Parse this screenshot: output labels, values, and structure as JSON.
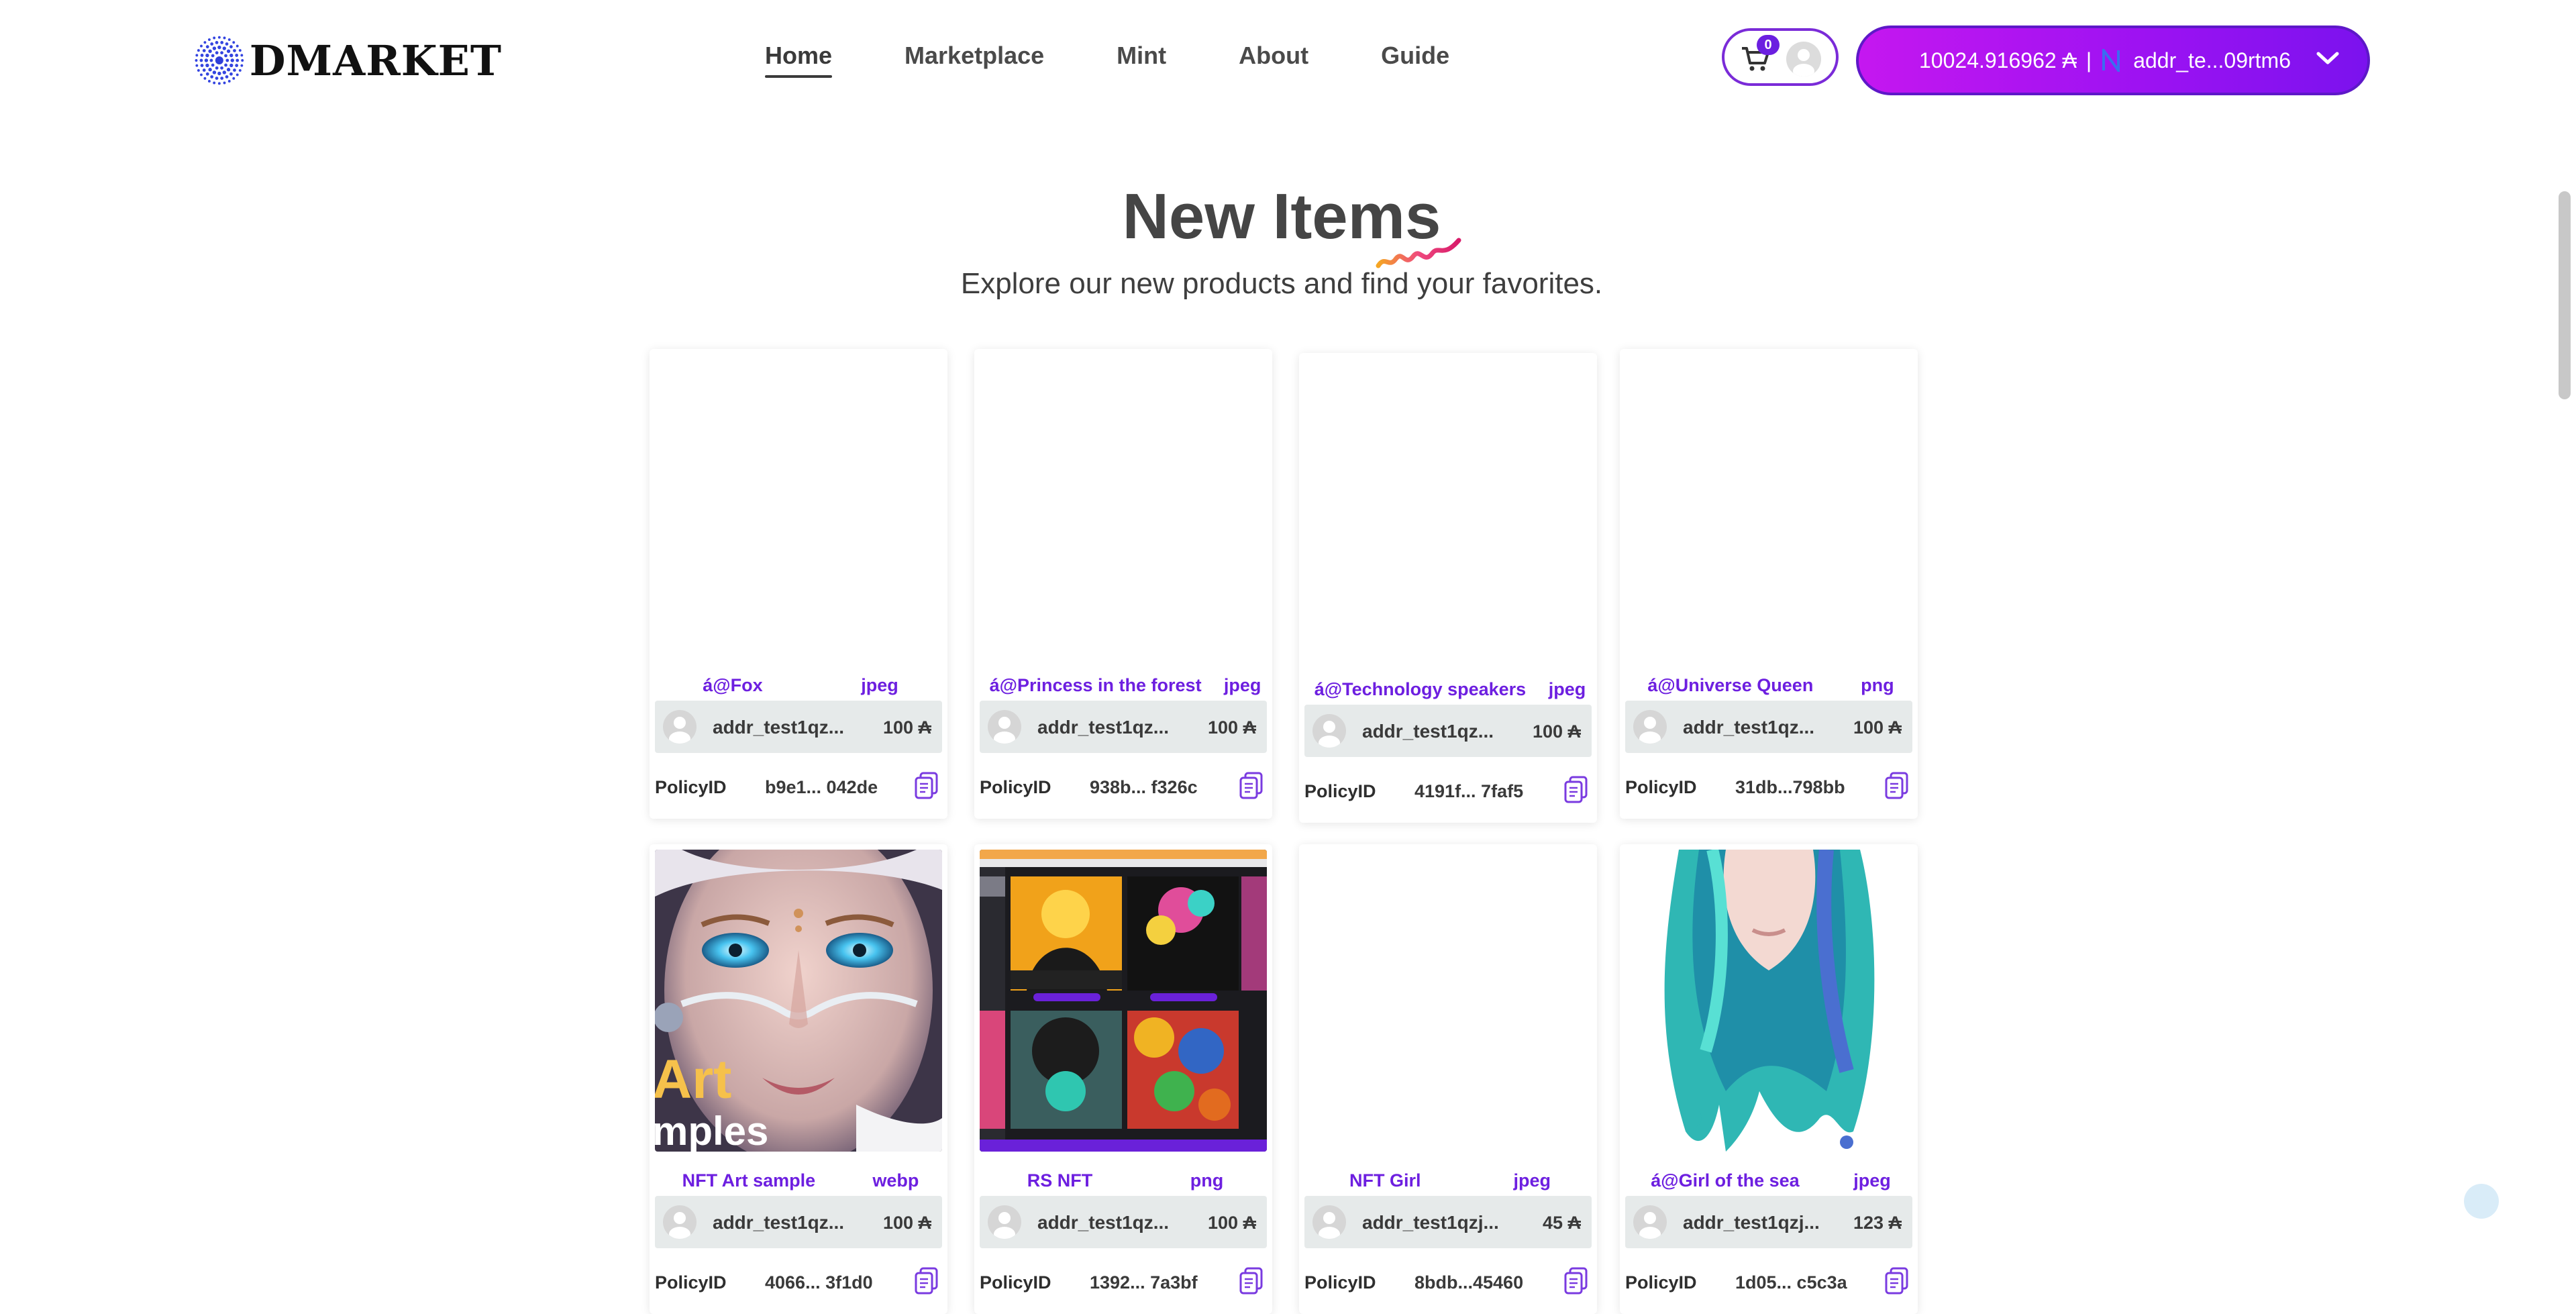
{
  "header": {
    "logo_text": "DMARKET",
    "nav": [
      {
        "label": "Home",
        "active": true
      },
      {
        "label": "Marketplace",
        "active": false
      },
      {
        "label": "Mint",
        "active": false
      },
      {
        "label": "About",
        "active": false
      },
      {
        "label": "Guide",
        "active": false
      }
    ],
    "cart_count": "0",
    "wallet": {
      "balance": "10024.916962 ₳",
      "separator": "|",
      "address": "addr_te...09rtm6",
      "token_icon": "cardano-n-icon"
    }
  },
  "hero": {
    "title": "New Items",
    "subtitle": "Explore our new products and find your favorites."
  },
  "cards": [
    {
      "glyph": "",
      "name": "á@Fox",
      "type": "jpeg",
      "owner": "addr_test1qz...",
      "price": "100 ₳",
      "policy_label": "PolicyID",
      "policy_id": "b9e1... 042de",
      "image": "blank"
    },
    {
      "glyph": "",
      "name": "á@Princess in the forest",
      "type": "jpeg",
      "owner": "addr_test1qz...",
      "price": "100 ₳",
      "policy_label": "PolicyID",
      "policy_id": "938b... f326c",
      "image": "blank"
    },
    {
      "glyph": "",
      "name": "á@Technology speakers",
      "type": "jpeg",
      "owner": "addr_test1qz...",
      "price": "100 ₳",
      "policy_label": "PolicyID",
      "policy_id": "4191f... 7faf5",
      "image": "blank"
    },
    {
      "glyph": "",
      "name": "á@Universe Queen",
      "type": "png",
      "owner": "addr_test1qz...",
      "price": "100 ₳",
      "policy_label": "PolicyID",
      "policy_id": "31db...798bb",
      "image": "blank"
    },
    {
      "glyph": "",
      "name": "NFT Art sample",
      "type": "webp",
      "owner": "addr_test1qz...",
      "price": "100 ₳",
      "policy_label": "PolicyID",
      "policy_id": "4066... 3f1d0",
      "image": "nft-art-sample",
      "image_text": "Art\nmples"
    },
    {
      "glyph": "",
      "name": "RS NFT",
      "type": "png",
      "owner": "addr_test1qz...",
      "price": "100 ₳",
      "policy_label": "PolicyID",
      "policy_id": "1392... 7a3bf",
      "image": "rs-nft-screenshot"
    },
    {
      "glyph": "",
      "name": "NFT Girl",
      "type": "jpeg",
      "owner": "addr_test1qzj...",
      "price": "45 ₳",
      "policy_label": "PolicyID",
      "policy_id": "8bdb...45460",
      "image": "blank"
    },
    {
      "glyph": "",
      "name": "á@Girl of the sea",
      "type": "jpeg",
      "owner": "addr_test1qzj...",
      "price": "123 ₳",
      "policy_label": "PolicyID",
      "policy_id": "1d05... c5c3a",
      "image": "girl-of-the-sea"
    }
  ],
  "colors": {
    "accent": "#6d1fe0",
    "wallet_start": "#c517f0",
    "wallet_end": "#7b12ee"
  }
}
